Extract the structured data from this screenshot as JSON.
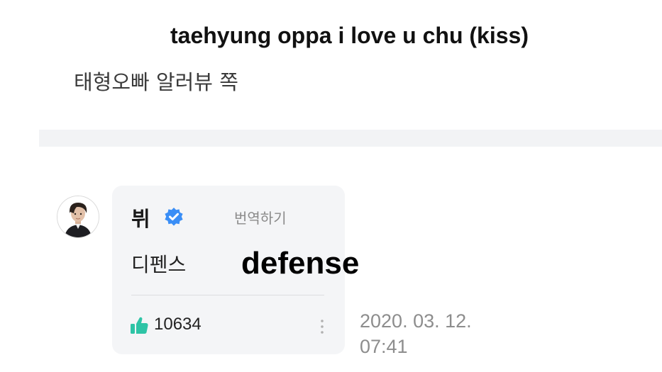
{
  "caption": {
    "english": "taehyung oppa i love u chu (kiss)",
    "korean": "태형오빠 알러뷰 쪽"
  },
  "comment": {
    "author": "뷔",
    "verified_icon": "verified-badge-icon",
    "translate_label": "번역하기",
    "text": "디펜스",
    "text_translation": "defense",
    "likes": "10634",
    "like_icon": "thumbs-up-icon",
    "more_icon": "vertical-ellipsis-icon",
    "date": "2020. 03. 12.",
    "time": "07:41"
  },
  "colors": {
    "accent_like": "#2ec4a6",
    "verified": "#3a8ef6",
    "bubble_bg": "#f4f5f7"
  }
}
